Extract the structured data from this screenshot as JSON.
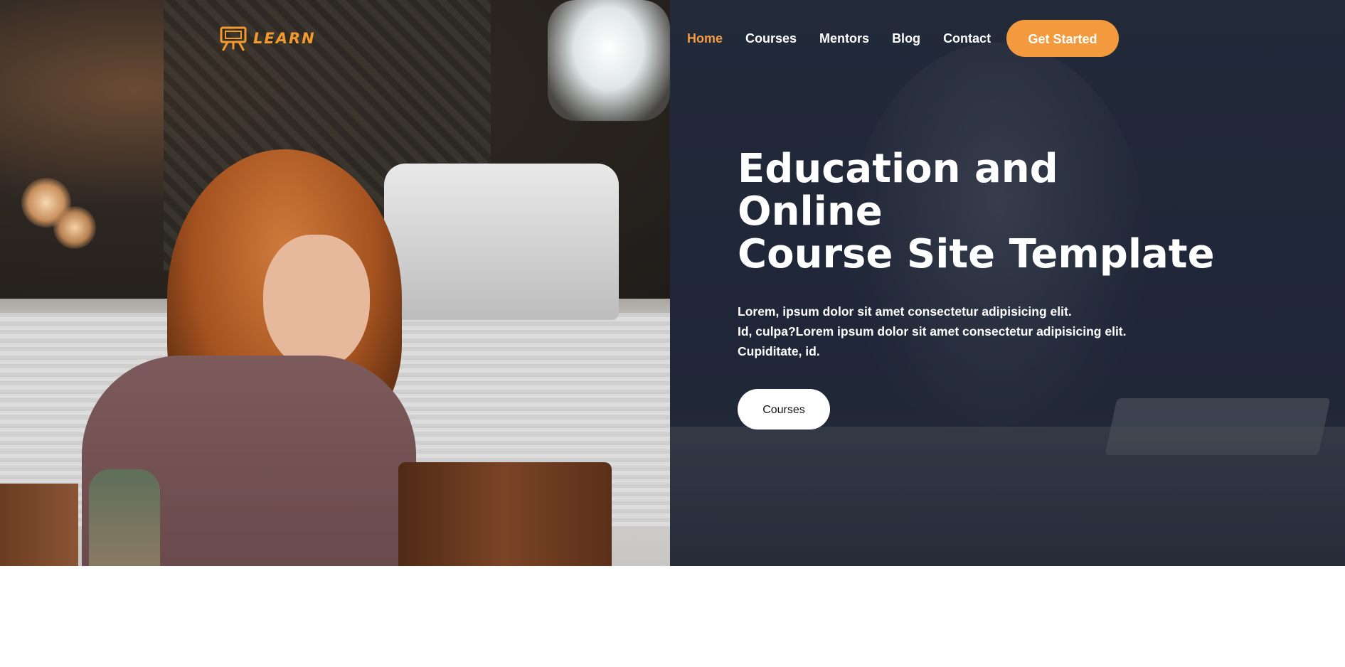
{
  "brand": {
    "logo_text": "LEARN",
    "logo_icon": "easel-board-icon",
    "accent_color": "#f39a3e"
  },
  "nav": {
    "items": [
      {
        "label": "Home",
        "active": true
      },
      {
        "label": "Courses",
        "active": false
      },
      {
        "label": "Mentors",
        "active": false
      },
      {
        "label": "Blog",
        "active": false
      },
      {
        "label": "Contact",
        "active": false
      }
    ],
    "cta_label": "Get Started"
  },
  "hero": {
    "headline_lines": [
      "Education and",
      "Online",
      "Course Site Template"
    ],
    "subcopy_lines": [
      "Lorem, ipsum dolor sit amet consectetur adipisicing elit.",
      "Id, culpa?Lorem ipsum dolor sit amet consectetur adipisicing elit.",
      "Cupiditate, id."
    ],
    "button_label": "Courses",
    "panel_color": "#1f2637"
  }
}
